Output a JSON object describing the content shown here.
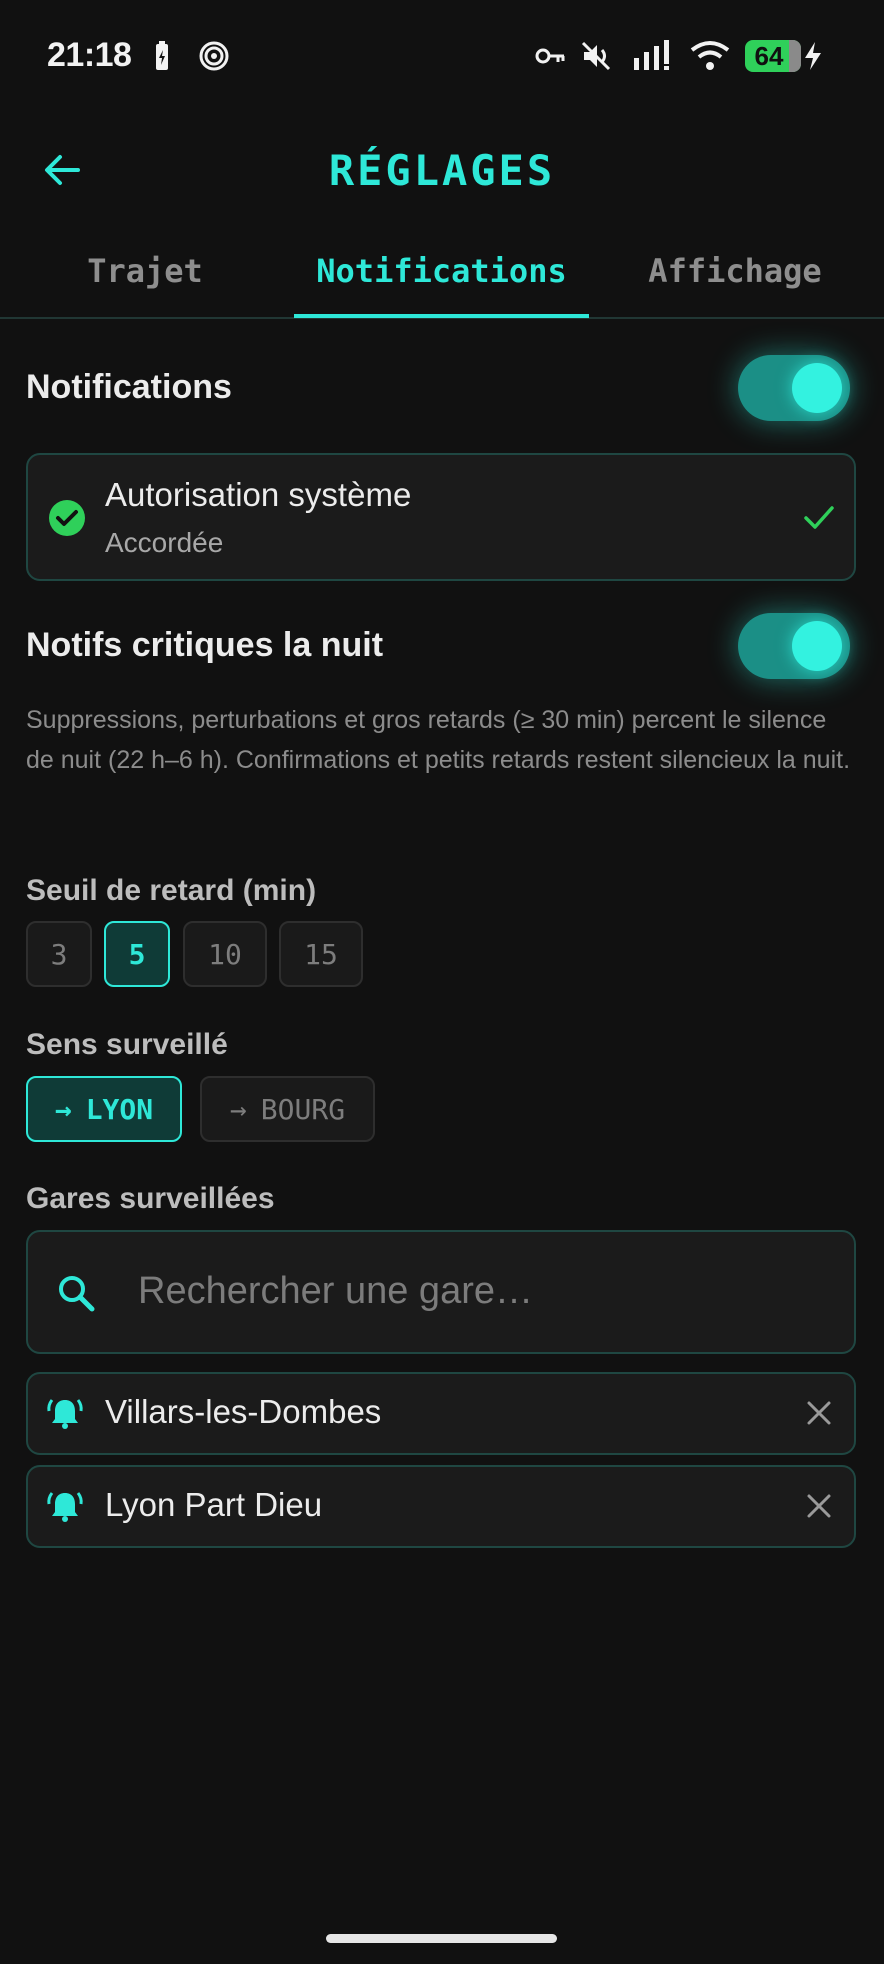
{
  "status_bar": {
    "time": "21:18",
    "battery": "64",
    "icons": [
      "battery-saver-icon",
      "activity-icon",
      "vpn-key-icon",
      "mute-icon",
      "signal-icon",
      "wifi-icon",
      "charging-icon"
    ]
  },
  "header": {
    "title": "RÉGLAGES",
    "back_icon": "arrow-left-icon"
  },
  "tabs": [
    {
      "label": "Trajet",
      "active": false
    },
    {
      "label": "Notifications",
      "active": true
    },
    {
      "label": "Affichage",
      "active": false
    }
  ],
  "notifications": {
    "label": "Notifications",
    "enabled": true
  },
  "permission": {
    "title": "Autorisation système",
    "status": "Accordée"
  },
  "night": {
    "label": "Notifs critiques la nuit",
    "enabled": true,
    "description": "Suppressions, perturbations et gros retards (≥ 30 min) percent le silence de nuit (22 h–6 h). Confirmations et petits retards restent silencieux la nuit."
  },
  "threshold": {
    "label": "Seuil de retard (min)",
    "options": [
      "3",
      "5",
      "10",
      "15"
    ],
    "selected": "5"
  },
  "direction": {
    "label": "Sens surveillé",
    "options": [
      {
        "label": "LYON",
        "active": true
      },
      {
        "label": "BOURG",
        "active": false
      }
    ]
  },
  "stations": {
    "label": "Gares surveillées",
    "search_placeholder": "Rechercher une gare…",
    "items": [
      "Villars-les-Dombes",
      "Lyon Part Dieu"
    ]
  },
  "colors": {
    "accent": "#2ee8d8",
    "background": "#111111",
    "card": "#1b1b1b",
    "success": "#2fd05a"
  }
}
